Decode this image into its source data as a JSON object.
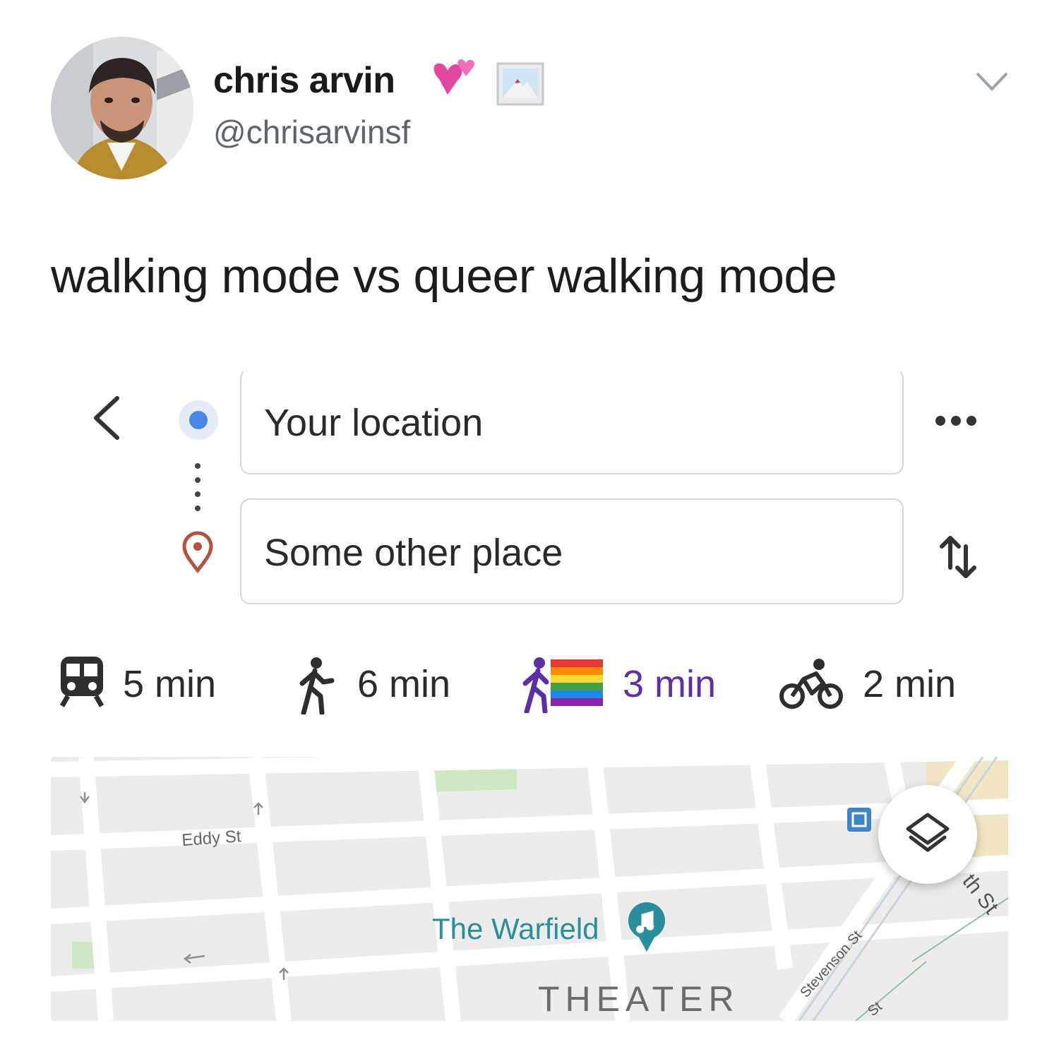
{
  "tweet": {
    "display_name": "chris arvin",
    "handle": "@chrisarvinsf",
    "text": "walking mode vs queer walking mode"
  },
  "directions": {
    "origin": "Your location",
    "destination": "Some other place"
  },
  "modes": [
    {
      "icon": "train-icon",
      "duration": "5 min"
    },
    {
      "icon": "walking-icon",
      "duration": "6 min"
    },
    {
      "icon": "walking-rainbow-flag-icon",
      "duration": "3 min",
      "accent": "#5d2ea6"
    },
    {
      "icon": "bicycle-icon",
      "duration": "2 min"
    }
  ],
  "map": {
    "street_eddy": "Eddy St",
    "place_name": "The Warfield",
    "district": "THEATER",
    "street_stevenson": "Stevenson St",
    "street_6th": "th St",
    "street_st": "St"
  },
  "colors": {
    "origin_dot": "#4a86e8",
    "pin": "#b3533f",
    "place_teal": "#2a8e9c"
  }
}
